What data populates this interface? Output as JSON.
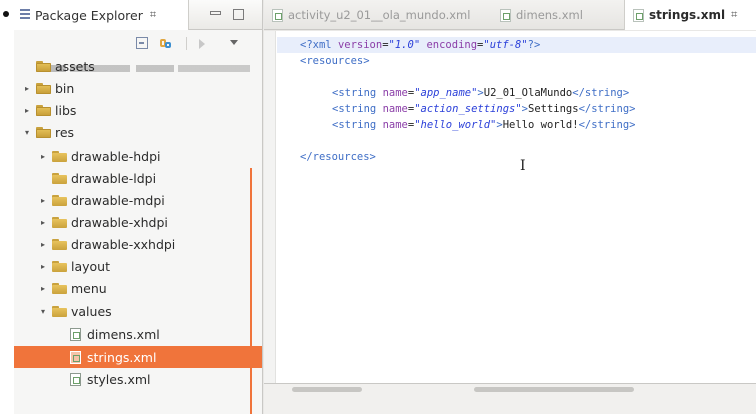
{
  "explorer": {
    "title": "Package Explorer",
    "close_glyph": "⌗",
    "items": [
      {
        "label": "assets",
        "indent": 1,
        "twisty": ""
      },
      {
        "label": "bin",
        "indent": 1,
        "twisty": "▸"
      },
      {
        "label": "libs",
        "indent": 1,
        "twisty": "▸"
      },
      {
        "label": "res",
        "indent": 1,
        "twisty": "▾"
      },
      {
        "label": "drawable-hdpi",
        "indent": 2,
        "twisty": "▸"
      },
      {
        "label": "drawable-ldpi",
        "indent": 2,
        "twisty": ""
      },
      {
        "label": "drawable-mdpi",
        "indent": 2,
        "twisty": "▸"
      },
      {
        "label": "drawable-xhdpi",
        "indent": 2,
        "twisty": "▸"
      },
      {
        "label": "drawable-xxhdpi",
        "indent": 2,
        "twisty": "▸"
      },
      {
        "label": "layout",
        "indent": 2,
        "twisty": "▸"
      },
      {
        "label": "menu",
        "indent": 2,
        "twisty": "▸"
      },
      {
        "label": "values",
        "indent": 2,
        "twisty": "▾"
      },
      {
        "label": "dimens.xml",
        "indent": 3,
        "twisty": ""
      },
      {
        "label": "strings.xml",
        "indent": 3,
        "twisty": ""
      },
      {
        "label": "styles.xml",
        "indent": 3,
        "twisty": ""
      }
    ],
    "selected_item": "strings.xml",
    "selection_color": "#f0743b"
  },
  "editor": {
    "tabs": [
      {
        "label": "activity_u2_01__ola_mundo.xml",
        "active": false
      },
      {
        "label": "dimens.xml",
        "active": false
      },
      {
        "label": "strings.xml",
        "active": true
      }
    ],
    "active_tab_close": "⌗",
    "lines": {
      "l1_open": "<?xml ",
      "l1_attr1": "version",
      "l1_eq1": "=",
      "l1_val1": "\"1.0\"",
      "l1_attr2": " encoding",
      "l1_eq2": "=",
      "l1_val2": "\"utf-8\"",
      "l1_close": "?>",
      "l2": "<resources>",
      "str_open": "<string ",
      "name_attr": "name",
      "eq": "=",
      "s1_name": "\"app_name\"",
      "s1_text": "U2_01_OlaMundo",
      "s2_name": "\"action_settings\"",
      "s2_text": "Settings",
      "s3_name": "\"hello_world\"",
      "s3_text": "Hello world!",
      "gt": ">",
      "str_close": "</string>",
      "l_end": "</resources>"
    },
    "text_cursor": "I"
  }
}
